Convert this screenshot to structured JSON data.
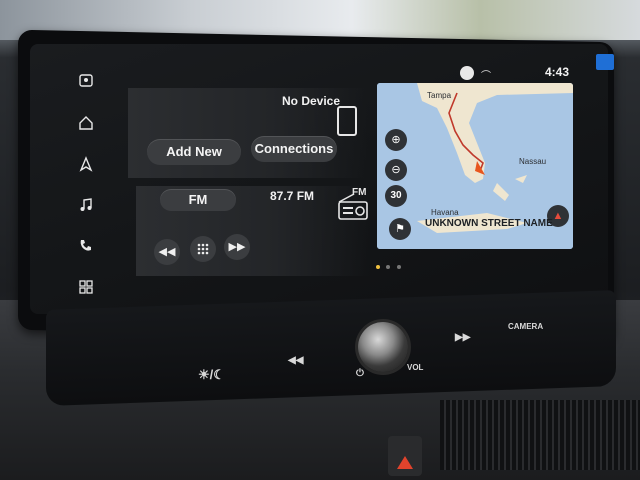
{
  "status_bar": {
    "time": "4:43"
  },
  "left_rail": {
    "items": [
      {
        "name": "assistant-icon",
        "glyph": "⚇"
      },
      {
        "name": "home-icon",
        "glyph": "⌂"
      },
      {
        "name": "navigation-icon",
        "glyph": "▲"
      },
      {
        "name": "music-icon",
        "glyph": "♫"
      },
      {
        "name": "phone-icon",
        "glyph": "✆"
      },
      {
        "name": "apps-grid-icon",
        "glyph": "▦"
      }
    ]
  },
  "phone_card": {
    "device_status": "No Device",
    "add_new_label": "Add New",
    "connections_label": "Connections"
  },
  "radio_card": {
    "band_label": "FM",
    "frequency": "87.7 FM",
    "source_icon_label": "FM"
  },
  "map": {
    "labels": {
      "tampa": "Tampa",
      "nassau": "Nassau",
      "havana": "Havana"
    },
    "street_name": "UNKNOWN STREET NAME",
    "zoom_scale": "30"
  },
  "hardware": {
    "camera_label": "CAMERA",
    "vol_label": "VOL"
  },
  "colors": {
    "accent_route": "#c0392b",
    "position_arrow": "#e8561e",
    "map_water": "#a9c6e4",
    "map_land": "#efe6d0"
  }
}
